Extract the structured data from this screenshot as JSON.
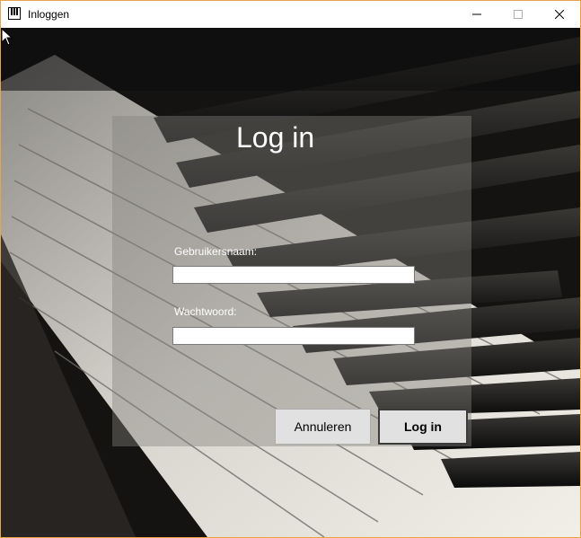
{
  "window": {
    "title": "Inloggen",
    "app_icon": "piano-icon",
    "controls": [
      "minimize-icon",
      "maximize-icon",
      "close-icon"
    ]
  },
  "form": {
    "heading": "Log in",
    "username_label": "Gebruikersnaam:",
    "username_value": "",
    "password_label": "Wachtwoord:",
    "password_value": "",
    "cancel_label": "Annuleren",
    "submit_label": "Log in"
  },
  "colors": {
    "window_border": "#e8a44c",
    "button_bg": "#e1e1e1",
    "text_light": "#ffffff"
  }
}
